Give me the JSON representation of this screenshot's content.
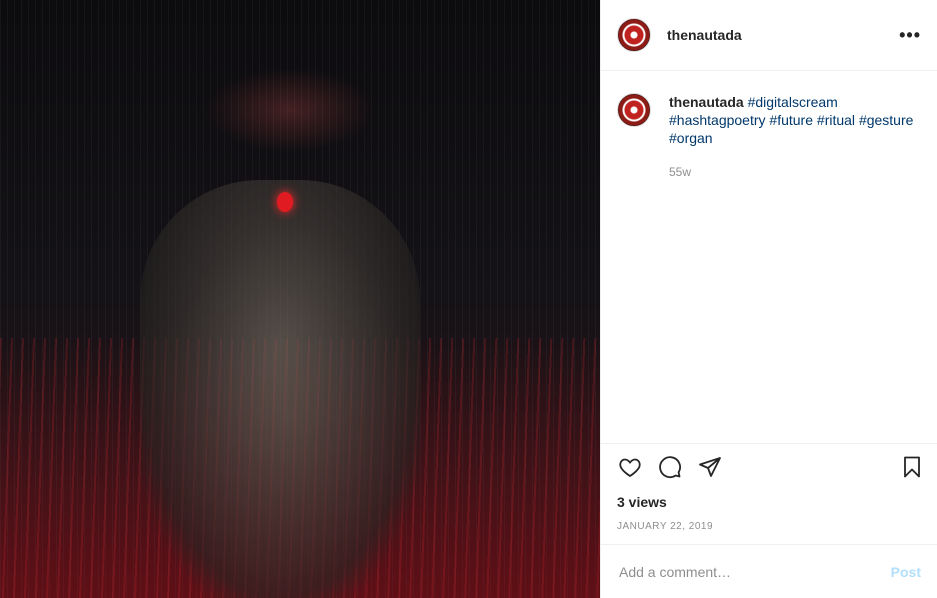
{
  "post": {
    "username": "thenautada",
    "more_label": "•••"
  },
  "caption": {
    "username": "thenautada",
    "tags": [
      "#digitalscream",
      "#hashtagpoetry",
      "#future",
      "#ritual",
      "#gesture",
      "#organ"
    ],
    "age": "55w"
  },
  "stats": {
    "views": "3 views",
    "date": "JANUARY 22, 2019"
  },
  "comment_box": {
    "placeholder": "Add a comment…",
    "post_label": "Post"
  },
  "icons": {
    "like": "heart-icon",
    "comment": "comment-icon",
    "share": "paper-plane-icon",
    "save": "bookmark-icon"
  }
}
